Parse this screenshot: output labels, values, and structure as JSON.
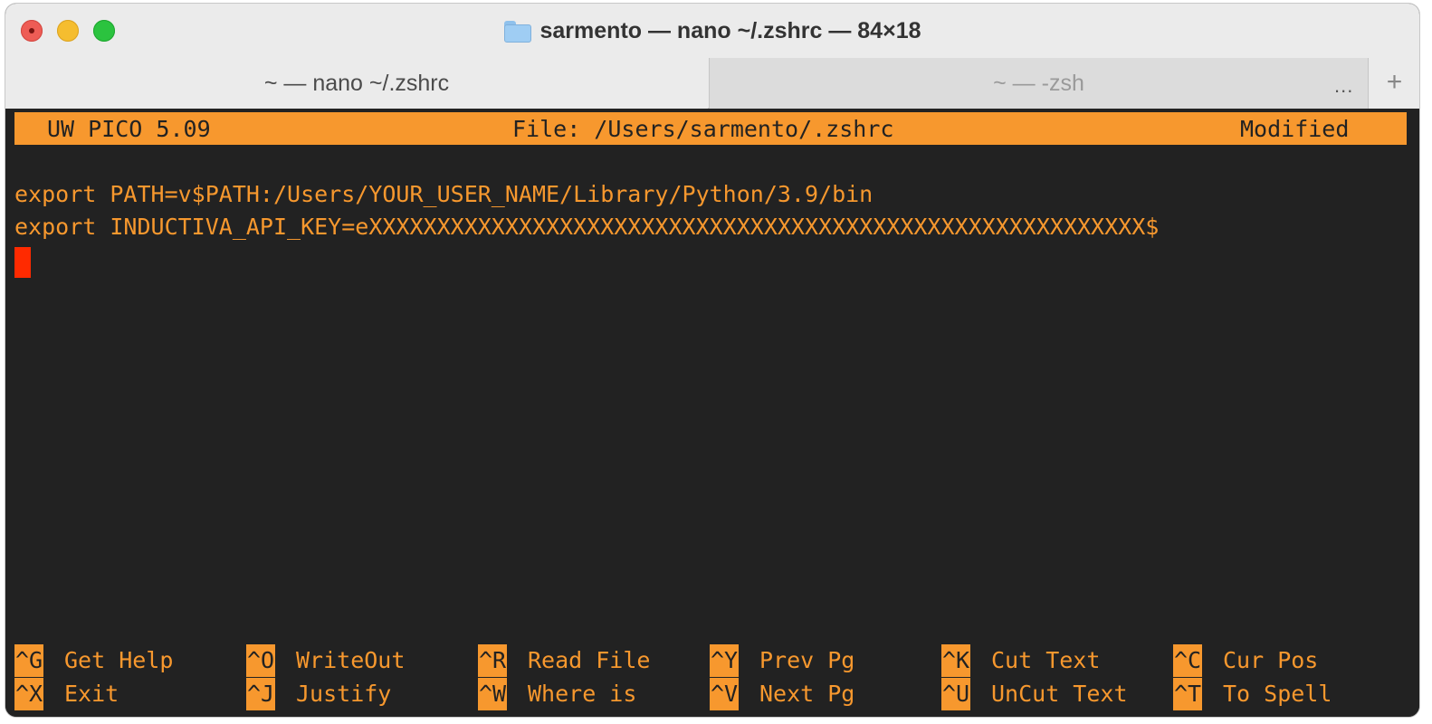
{
  "window": {
    "title": "sarmento — nano ~/.zshrc — 84×18",
    "folder_icon": "folder-icon"
  },
  "tabs": [
    {
      "label": "~ — nano ~/.zshrc",
      "active": true
    },
    {
      "label": "~ — -zsh",
      "active": false
    }
  ],
  "tab_overflow": "...",
  "tab_add": "+",
  "editor": {
    "header": {
      "app": "UW PICO 5.09",
      "file": "File: /Users/sarmento/.zshrc",
      "status": "Modified"
    },
    "lines": [
      "export PATH=v$PATH:/Users/YOUR_USER_NAME/Library/Python/3.9/bin",
      "export INDUCTIVA_API_KEY=eXXXXXXXXXXXXXXXXXXXXXXXXXXXXXXXXXXXXXXXXXXXXXXXXXXXXXXXXX$"
    ],
    "shortcuts": [
      {
        "key": "^G",
        "label": "Get Help"
      },
      {
        "key": "^O",
        "label": "WriteOut"
      },
      {
        "key": "^R",
        "label": "Read File"
      },
      {
        "key": "^Y",
        "label": "Prev Pg"
      },
      {
        "key": "^K",
        "label": "Cut Text"
      },
      {
        "key": "^C",
        "label": "Cur Pos"
      },
      {
        "key": "^X",
        "label": "Exit"
      },
      {
        "key": "^J",
        "label": "Justify"
      },
      {
        "key": "^W",
        "label": "Where is"
      },
      {
        "key": "^V",
        "label": "Next Pg"
      },
      {
        "key": "^U",
        "label": "UnCut Text"
      },
      {
        "key": "^T",
        "label": "To Spell"
      }
    ]
  },
  "colors": {
    "terminal_bg": "#222222",
    "accent": "#f7982e",
    "cursor": "#ff2a00"
  }
}
